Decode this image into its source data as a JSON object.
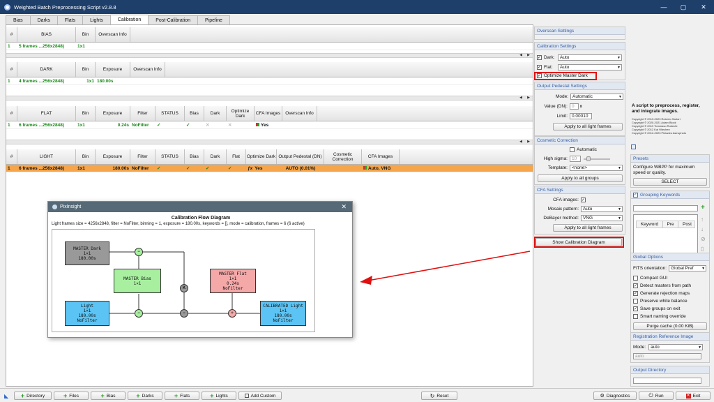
{
  "window": {
    "title": "Weighted Batch Preprocessing Script v2.8.8",
    "controls": [
      "—",
      "▢",
      "✕"
    ]
  },
  "tabs": [
    "Bias",
    "Darks",
    "Flats",
    "Lights",
    "Calibration",
    "Post-Calibration",
    "Pipeline"
  ],
  "bias_table": {
    "headers": [
      "#",
      "BIAS",
      "Bin",
      "Overscan Info"
    ],
    "row": [
      "1",
      "5 frames ...256x2848)",
      "1x1",
      ""
    ]
  },
  "dark_table": {
    "headers": [
      "#",
      "DARK",
      "Bin",
      "Exposure",
      "Overscan Info"
    ],
    "row": [
      "1",
      "4 frames ...256x2848)",
      "1x1",
      "180.00s",
      ""
    ]
  },
  "flat_table": {
    "headers": [
      "#",
      "FLAT",
      "Bin",
      "Exposure",
      "Filter",
      "STATUS",
      "Bias",
      "Dark",
      "Optimize Dark",
      "CFA Images",
      "Overscan Info"
    ],
    "row": [
      "1",
      "6 frames ...256x2848)",
      "1x1",
      "0.24s",
      "NoFilter",
      "✓",
      "✓",
      "✕",
      "✕",
      "Yes",
      ""
    ]
  },
  "light_table": {
    "headers": [
      "#",
      "LIGHT",
      "Bin",
      "Exposure",
      "Filter",
      "STATUS",
      "Bias",
      "Dark",
      "Flat",
      "Optimize Dark",
      "Output Pedestal (DN)",
      "Cosmetic Correction",
      "CFA Images"
    ],
    "row": [
      "1",
      "6 frames ...256x2848)",
      "1x1",
      "180.00s",
      "NoFilter",
      "✓",
      "✓",
      "✓",
      "✓",
      "Yes",
      "AUTO (0.01%)",
      "",
      "Auto, VNG"
    ]
  },
  "overscan": {
    "title": "Overscan Settings"
  },
  "calibration": {
    "title": "Calibration Settings",
    "dark_label": "Dark:",
    "dark_value": "Auto",
    "flat_label": "Flat:",
    "flat_value": "Auto",
    "optimize_label": "Optimize Master Dark"
  },
  "pedestal": {
    "title": "Output Pedestal Settings",
    "mode_label": "Mode:",
    "mode_value": "Automatic",
    "value_label": "Value (DN):",
    "value": "0",
    "limit_label": "Limit:",
    "limit": "0.00010",
    "apply": "Apply to all light frames"
  },
  "cosmetic": {
    "title": "Cosmetic Correction",
    "auto_label": "Automatic",
    "sigma_label": "High sigma:",
    "sigma": "10",
    "template_label": "Template:",
    "template": "<none>",
    "apply": "Apply to all groups"
  },
  "cfa": {
    "title": "CFA Settings",
    "images_label": "CFA images:",
    "mosaic_label": "Mosaic pattern:",
    "mosaic": "Auto",
    "debayer_label": "DeBayer method:",
    "debayer": "VNG",
    "apply": "Apply to all light frames",
    "show_diagram": "Show Calibration Diagram"
  },
  "about": {
    "text": "A script to preprocess, register, and integrate images.",
    "credits": [
      "Copyright © 2019-2023 Roberto Sartori",
      "Copyright © 2020-2021 Adam Block",
      "Copyright © 2019 Tommaso Rubechi",
      "Copyright © 2012 Kai Wiechen",
      "Copyright © 2012-2023 Pleiades Astrophoto"
    ]
  },
  "presets": {
    "title": "Presets",
    "text": "Configure WBPP for maximum speed or quality.",
    "select": "SELECT"
  },
  "grouping": {
    "title": "Grouping Keywords",
    "headers": [
      "Keyword",
      "Pre",
      "Post"
    ]
  },
  "global": {
    "title": "Global Options",
    "fits_label": "FITS orientation:",
    "fits_value": "Global Pref",
    "options": [
      {
        "label": "Compact GUI",
        "checked": false
      },
      {
        "label": "Detect masters from path",
        "checked": true
      },
      {
        "label": "Generate rejection maps",
        "checked": true
      },
      {
        "label": "Preserve white balance",
        "checked": false
      },
      {
        "label": "Save groups on exit",
        "checked": true
      },
      {
        "label": "Smart naming override",
        "checked": false
      }
    ],
    "purge": "Purge cache (0.00 KiB)"
  },
  "registration": {
    "title": "Registration Reference Image",
    "mode_label": "Mode:",
    "mode_value": "auto",
    "auto_field": "auto"
  },
  "output": {
    "title": "Output Directory"
  },
  "dialog": {
    "app": "PixInsight",
    "title": "Calibration Flow Diagram",
    "summary": "Light frames size = 4256x2848, filter = NoFilter, binning = 1, exposure = 180.00s, keywords = [], mode = calibration, frames = 6 (6 active)",
    "nodes": {
      "dark": [
        "MASTER Dark",
        "1×1",
        "180.00s"
      ],
      "bias": [
        "MASTER Bias",
        "1×1"
      ],
      "flat": [
        "MASTER Flat",
        "1×1",
        "0.24s",
        "NoFilter"
      ],
      "light": [
        "Light",
        "1×1",
        "180.00s",
        "NoFilter"
      ],
      "calibrated": [
        "CALIBRATED Light",
        "1×1",
        "180.00s",
        "NoFilter"
      ]
    },
    "ops": [
      "−",
      "−",
      "K",
      "−",
      "÷"
    ]
  },
  "bottom": {
    "directory": "Directory",
    "files": "Files",
    "bias": "Bias",
    "darks": "Darks",
    "flats": "Flats",
    "lights": "Lights",
    "add_custom": "Add Custom",
    "reset": "Reset",
    "diagnostics": "Diagnostics",
    "run": "Run",
    "exit": "Exit"
  },
  "colors": {
    "highlight": "#e01010",
    "selected_row": "#f6a54a",
    "group_text": "#1a8a1a"
  }
}
